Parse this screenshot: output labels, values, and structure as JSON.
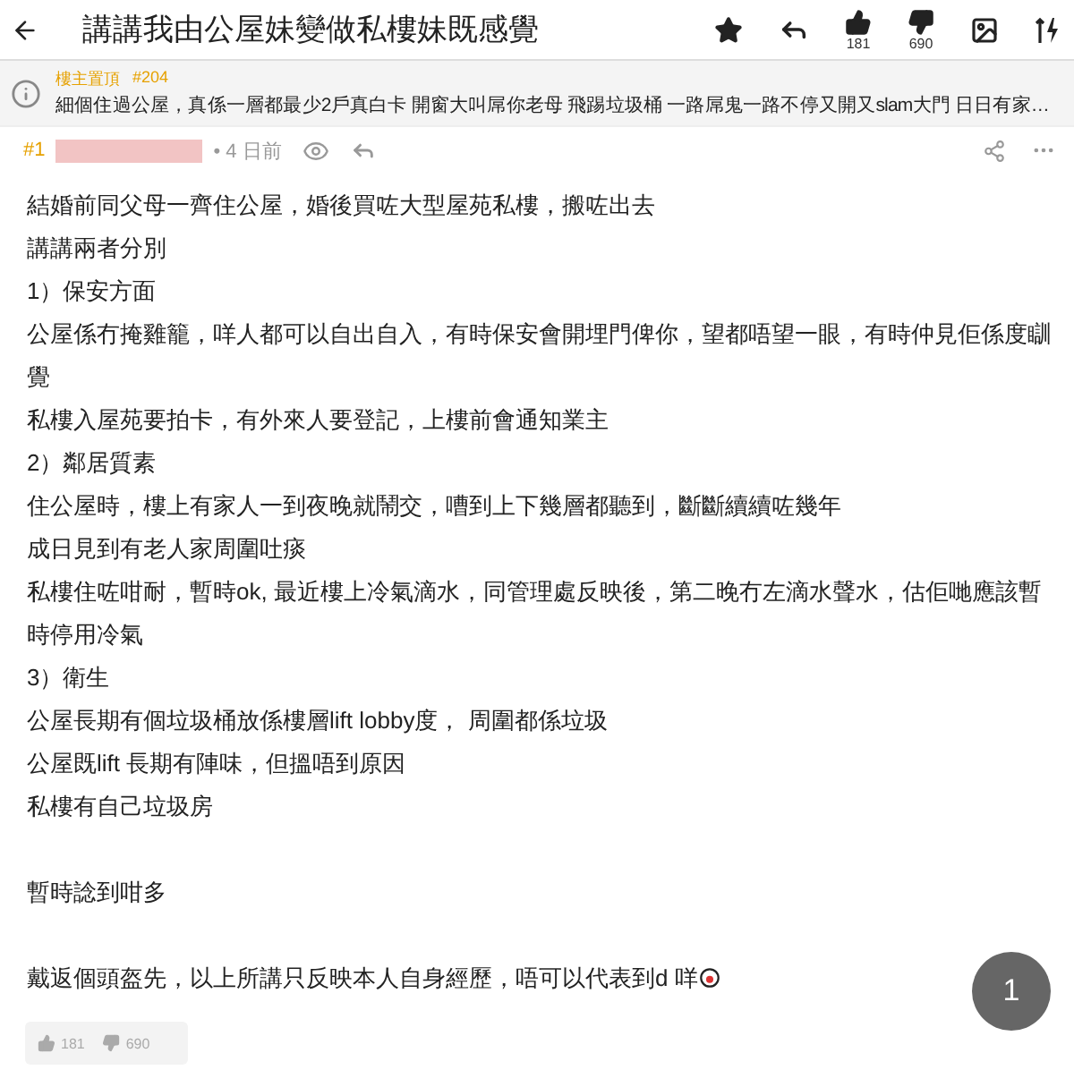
{
  "header": {
    "title": "講講我由公屋妹變做私樓妹既感覺",
    "likes": "181",
    "dislikes": "690"
  },
  "pinned": {
    "label": "樓主置頂",
    "number": "#204",
    "text": "細個住過公屋，真係一層都最少2戶真白卡 開窗大叫屌你老母 飛踢垃圾桶 一路屌鬼一路不停又開又slam大門 日日有家…"
  },
  "post": {
    "floor": "#1",
    "time": "• 4 日前",
    "blocks": [
      {
        "lines": [
          "結婚前同父母一齊住公屋，婚後買咗大型屋苑私樓，搬咗出去",
          "講講兩者分別",
          "1）保安方面",
          "公屋係冇掩雞籠，咩人都可以自出自入，有時保安會開埋門俾你，望都唔望一眼，有時仲見佢係度瞓覺",
          "私樓入屋苑要拍卡，有外來人要登記，上樓前會通知業主",
          "2）鄰居質素",
          "住公屋時，樓上有家人一到夜晚就鬧交，嘈到上下幾層都聽到，斷斷續續咗幾年",
          "成日見到有老人家周圍吐痰",
          "私樓住咗咁耐，暫時ok, 最近樓上冷氣滴水，同管理處反映後，第二晚冇左滴水聲水，估佢哋應該暫時停用冷氣",
          "3）衛生",
          "公屋長期有個垃圾桶放係樓層lift lobby度， 周圍都係垃圾",
          "公屋既lift 長期有陣味，但搵唔到原因",
          "私樓有自己垃圾房"
        ]
      },
      {
        "lines": [
          "暫時諗到咁多"
        ]
      },
      {
        "lines": [
          "戴返個頭盔先，以上所講只反映本人自身經歷，唔可以代表到d 咩"
        ],
        "ends_with_emoji": true
      }
    ],
    "likes": "181",
    "dislikes": "690"
  },
  "page_button": "1"
}
